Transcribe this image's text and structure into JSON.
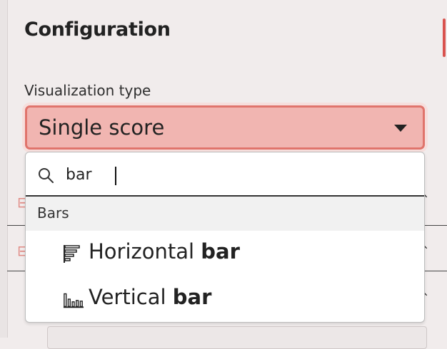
{
  "panel": {
    "title": "Configuration",
    "field_label": "Visualization type"
  },
  "select": {
    "value": "Single score",
    "icon": "chevron-down-icon"
  },
  "dropdown": {
    "search": {
      "value": "bar",
      "placeholder": "",
      "icon": "search-icon"
    },
    "group": "Bars",
    "options": [
      {
        "label_prefix": "Horizontal ",
        "label_match": "bar",
        "icon": "horizontal-bar-chart-icon"
      },
      {
        "label_prefix": "Vertical ",
        "label_match": "bar",
        "icon": "vertical-bar-chart-icon"
      }
    ]
  },
  "colors": {
    "select_bg": "#f1b5b1",
    "select_border": "#e0746c",
    "accent": "#d9534f",
    "panel_bg": "#f1ecec"
  }
}
